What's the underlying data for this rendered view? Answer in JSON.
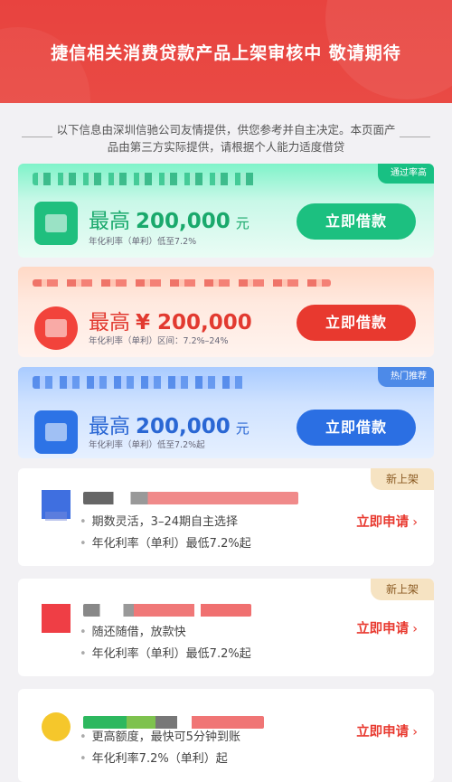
{
  "header": {
    "title": "捷信相关消费贷款产品上架审核中 敬请期待"
  },
  "notice": {
    "text": "以下信息由深圳信驰公司友情提供，供您参考并自主决定。本页面产品由第三方实际提供，请根据个人能力适度借贷"
  },
  "featured": [
    {
      "tag": "通过率高",
      "amount_label": "最高",
      "amount": "200,000",
      "unit": "元",
      "rate": "年化利率（单利）低至7.2%",
      "cta": "立即借款",
      "theme": "#1cc080"
    },
    {
      "tag": "",
      "amount_label": "最高",
      "amount": "¥ 200,000",
      "unit": "",
      "rate": "年化利率（单利）区间：7.2%–24%",
      "cta": "立即借款",
      "theme": "#e8392f"
    },
    {
      "tag": "热门推荐",
      "amount_label": "最高",
      "amount": "200,000",
      "unit": "元",
      "rate": "年化利率（单利）低至7.2%起",
      "cta": "立即借款",
      "theme": "#2b6fe3"
    }
  ],
  "items": [
    {
      "tag": "新上架",
      "bullets": [
        "期数灵活，3–24期自主选择",
        "年化利率（单利）最低7.2%起"
      ],
      "cta": "立即申请"
    },
    {
      "tag": "新上架",
      "bullets": [
        "随还随借，放款快",
        "年化利率（单利）最低7.2%起"
      ],
      "cta": "立即申请"
    },
    {
      "tag": "",
      "bullets": [
        "更高额度，最快可5分钟到账",
        "年化利率7.2%（单利）起"
      ],
      "cta": "立即申请"
    }
  ]
}
